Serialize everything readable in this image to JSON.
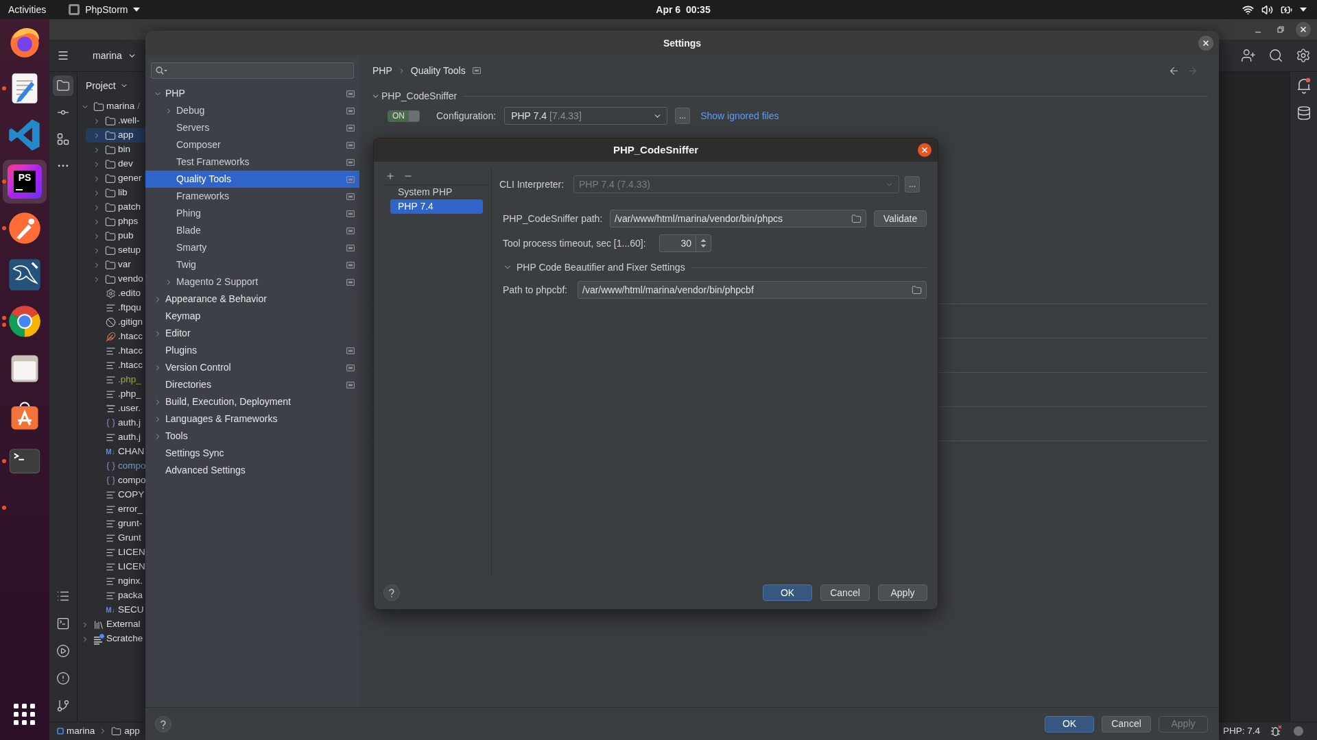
{
  "top_bar": {
    "activities": "Activities",
    "app_menu": "PhpStorm",
    "clock": "Apr 6  00:35"
  },
  "dock": [
    {
      "kind": "firefox",
      "selected": false,
      "running": false,
      "multiple": false
    },
    {
      "kind": "text-editor",
      "selected": false,
      "running": true,
      "multiple": false
    },
    {
      "kind": "code-editor",
      "selected": false,
      "running": false,
      "multiple": false
    },
    {
      "kind": "phpstorm",
      "selected": true,
      "running": true,
      "multiple": false,
      "badge": "PS"
    },
    {
      "kind": "postman",
      "selected": false,
      "running": true,
      "multiple": false
    },
    {
      "kind": "workbench",
      "selected": false,
      "running": false,
      "multiple": false
    },
    {
      "kind": "chrome",
      "selected": false,
      "running": true,
      "multiple": true
    },
    {
      "kind": "files",
      "selected": false,
      "running": false,
      "multiple": false
    },
    {
      "kind": "software",
      "selected": false,
      "running": false,
      "multiple": false
    },
    {
      "kind": "terminal",
      "selected": false,
      "running": true,
      "multiple": false
    },
    {
      "kind": "hidden",
      "selected": false,
      "running": true,
      "multiple": false
    }
  ],
  "ide": {
    "project": "marina",
    "tool_strip_top": [
      {
        "kind": "project",
        "selected": true
      },
      {
        "kind": "commit",
        "selected": false
      },
      {
        "kind": "structure",
        "selected": false
      },
      {
        "kind": "more",
        "selected": false
      }
    ],
    "tool_strip_bottom": [
      {
        "kind": "list",
        "selected": false
      },
      {
        "kind": "terminal",
        "selected": false
      },
      {
        "kind": "run",
        "selected": false
      },
      {
        "kind": "problems",
        "selected": false
      },
      {
        "kind": "git",
        "selected": false
      }
    ],
    "panel_title": "Project",
    "tree": [
      {
        "name": "marina",
        "suffix": "/",
        "kind": "folder",
        "expanded": true,
        "selected": false,
        "children": [
          {
            "name": ".well-",
            "kind": "folder",
            "expanded": false,
            "selected": false
          },
          {
            "name": "app",
            "kind": "folder",
            "expanded": false,
            "selected": true
          },
          {
            "name": "bin",
            "kind": "folder",
            "expanded": false,
            "selected": false
          },
          {
            "name": "dev",
            "kind": "folder",
            "expanded": false,
            "selected": false
          },
          {
            "name": "gener",
            "kind": "folder",
            "expanded": false,
            "selected": false
          },
          {
            "name": "lib",
            "kind": "folder",
            "expanded": false,
            "selected": false
          },
          {
            "name": "patch",
            "kind": "folder",
            "expanded": false,
            "selected": false
          },
          {
            "name": "phps",
            "kind": "folder",
            "expanded": false,
            "selected": false
          },
          {
            "name": "pub",
            "kind": "folder",
            "expanded": false,
            "selected": false
          },
          {
            "name": "setup",
            "kind": "folder",
            "expanded": false,
            "selected": false
          },
          {
            "name": "var",
            "kind": "folder",
            "expanded": false,
            "selected": false
          },
          {
            "name": "vendo",
            "kind": "folder",
            "expanded": false,
            "selected": false
          },
          {
            "name": ".edito",
            "kind": "settings",
            "selected": false
          },
          {
            "name": ".ftpqu",
            "kind": "text",
            "selected": false
          },
          {
            "name": ".gitign",
            "kind": "ignore",
            "selected": false
          },
          {
            "name": ".htacc",
            "kind": "feather",
            "selected": false
          },
          {
            "name": ".htacc",
            "kind": "text",
            "selected": false
          },
          {
            "name": ".htacc",
            "kind": "text",
            "selected": false
          },
          {
            "name": ".php_",
            "kind": "text",
            "selected": false,
            "color": "#a8a83a"
          },
          {
            "name": ".php_",
            "kind": "text",
            "selected": false
          },
          {
            "name": ".user.",
            "kind": "ini",
            "selected": false
          },
          {
            "name": "auth.j",
            "kind": "json",
            "selected": false
          },
          {
            "name": "auth.j",
            "kind": "text",
            "selected": false
          },
          {
            "name": "CHAN",
            "kind": "markdown",
            "badge": "M↓",
            "selected": false
          },
          {
            "name": "compo",
            "kind": "json",
            "selected": false,
            "color": "#6f9fdb"
          },
          {
            "name": "compo",
            "kind": "json",
            "selected": false
          },
          {
            "name": "COPY",
            "kind": "text",
            "selected": false
          },
          {
            "name": "error_",
            "kind": "text",
            "selected": false
          },
          {
            "name": "grunt-",
            "kind": "text",
            "selected": false
          },
          {
            "name": "Grunt",
            "kind": "text",
            "selected": false
          },
          {
            "name": "LICEN",
            "kind": "text",
            "selected": false
          },
          {
            "name": "LICEN",
            "kind": "text",
            "selected": false
          },
          {
            "name": "nginx.",
            "kind": "text",
            "selected": false
          },
          {
            "name": "packa",
            "kind": "text",
            "selected": false
          },
          {
            "name": "SECU",
            "kind": "markdown",
            "badge": "M↓",
            "selected": false
          }
        ]
      },
      {
        "name": "External",
        "kind": "library",
        "expanded": false,
        "selected": false
      },
      {
        "name": "Scratche",
        "kind": "scratches",
        "expanded": false,
        "selected": false
      }
    ],
    "breadcrumb": [
      {
        "kind": "module",
        "label": "marina"
      },
      {
        "kind": "folder",
        "label": "app"
      }
    ],
    "php_version": "PHP: 7.4",
    "notifications": {
      "unread": true
    }
  },
  "settings": {
    "title": "Settings",
    "tree": [
      {
        "label": "PHP",
        "expanded": true,
        "selected": false,
        "scope": true,
        "children": [
          {
            "label": "Debug",
            "expanded": false,
            "selected": false,
            "scope": true
          },
          {
            "label": "Servers",
            "selected": false,
            "scope": true
          },
          {
            "label": "Composer",
            "selected": false,
            "scope": true
          },
          {
            "label": "Test Frameworks",
            "selected": false,
            "scope": true
          },
          {
            "label": "Quality Tools",
            "selected": true,
            "scope": true
          },
          {
            "label": "Frameworks",
            "selected": false,
            "scope": true
          },
          {
            "label": "Phing",
            "selected": false,
            "scope": true
          },
          {
            "label": "Blade",
            "selected": false,
            "scope": true
          },
          {
            "label": "Smarty",
            "selected": false,
            "scope": true
          },
          {
            "label": "Twig",
            "selected": false,
            "scope": true
          },
          {
            "label": "Magento 2 Support",
            "expanded": false,
            "selected": false,
            "scope": true
          }
        ]
      },
      {
        "label": "Appearance & Behavior",
        "expanded": false,
        "selected": false,
        "scope": false
      },
      {
        "label": "Keymap",
        "selected": false,
        "scope": false
      },
      {
        "label": "Editor",
        "expanded": false,
        "selected": false,
        "scope": false
      },
      {
        "label": "Plugins",
        "selected": false,
        "scope": true
      },
      {
        "label": "Version Control",
        "expanded": false,
        "selected": false,
        "scope": true
      },
      {
        "label": "Directories",
        "selected": false,
        "scope": true
      },
      {
        "label": "Build, Execution, Deployment",
        "expanded": false,
        "selected": false,
        "scope": false
      },
      {
        "label": "Languages & Frameworks",
        "expanded": false,
        "selected": false,
        "scope": false
      },
      {
        "label": "Tools",
        "expanded": false,
        "selected": false,
        "scope": false
      },
      {
        "label": "Settings Sync",
        "selected": false,
        "scope": false
      },
      {
        "label": "Advanced Settings",
        "selected": false,
        "scope": false
      }
    ],
    "page": {
      "breadcrumb": [
        "PHP",
        "Quality Tools"
      ],
      "scope": true,
      "nav": [
        {
          "kind": "back",
          "disabled": false
        },
        {
          "kind": "forward",
          "disabled": true
        }
      ]
    },
    "section": {
      "title": "PHP_CodeSniffer",
      "expanded": true,
      "switch": {
        "label": "ON",
        "on": true
      },
      "configuration_label": "Configuration:",
      "configuration": {
        "value": "PHP 7.4",
        "detail": "[7.4.33]"
      },
      "more": "...",
      "link": "Show ignored files"
    },
    "buttons": [
      {
        "kind": "ok",
        "label": "OK",
        "disabled": false
      },
      {
        "kind": "cancel",
        "label": "Cancel",
        "disabled": false
      },
      {
        "kind": "apply",
        "label": "Apply",
        "disabled": true
      }
    ]
  },
  "dialog": {
    "title": "PHP_CodeSniffer",
    "interpreters": [
      {
        "name": "System PHP",
        "selected": false
      },
      {
        "name": "PHP 7.4",
        "selected": true
      }
    ],
    "cli": {
      "label": "CLI Interpreter:",
      "value": "PHP 7.4 (7.4.33)",
      "disabled": true,
      "more": "..."
    },
    "path": {
      "label": "PHP_CodeSniffer path:",
      "value": "/var/www/html/marina/vendor/bin/phpcs",
      "action": "Validate"
    },
    "timeout": {
      "label": "Tool process timeout, sec [1...60]:",
      "value": "30"
    },
    "fixer": {
      "title": "PHP Code Beautifier and Fixer Settings",
      "expanded": true,
      "label": "Path to phpcbf:",
      "value": "/var/www/html/marina/vendor/bin/phpcbf"
    },
    "buttons": [
      {
        "kind": "ok",
        "label": "OK",
        "disabled": false
      },
      {
        "kind": "cancel",
        "label": "Cancel",
        "disabled": false
      },
      {
        "kind": "apply",
        "label": "Apply",
        "disabled": false
      }
    ]
  }
}
